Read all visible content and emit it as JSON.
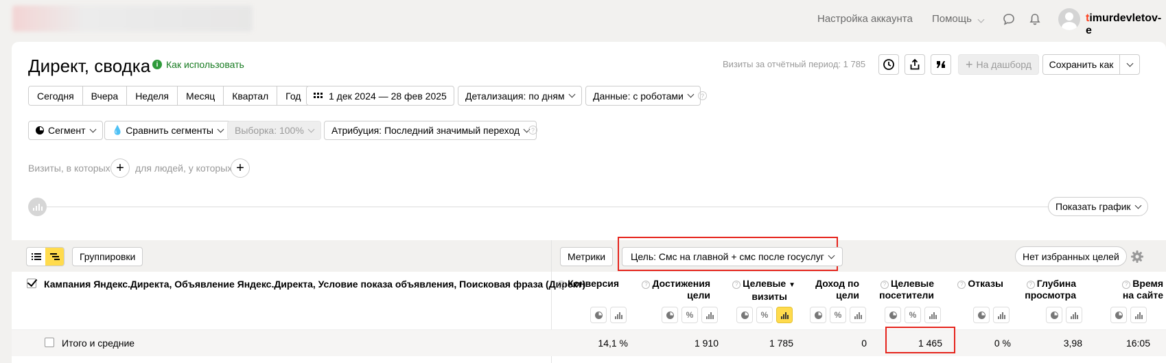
{
  "header": {
    "account_settings": "Настройка аккаунта",
    "help": "Помощь",
    "username_first": "t",
    "username_rest": "imurdevletov-e"
  },
  "page": {
    "title": "Директ, сводка",
    "how_to_use": "Как использовать",
    "visits_info": "Визиты за отчётный период: 1 785",
    "add_dashboard": "На дашборд",
    "save_as": "Сохранить как"
  },
  "periods": [
    "Сегодня",
    "Вчера",
    "Неделя",
    "Месяц",
    "Квартал",
    "Год"
  ],
  "filters": {
    "date_range": "1 дек 2024 — 28 фев 2025",
    "detail": "Детализация: по дням",
    "data": "Данные: с роботами",
    "segment": "Сегмент",
    "compare": "Сравнить сегменты",
    "sample": "Выборка: 100%",
    "attribution": "Атрибуция: Последний значимый переход"
  },
  "conditions": {
    "visits_where": "Визиты, в которых",
    "people_where": "для людей, у которых"
  },
  "graph": {
    "show_graph": "Показать график"
  },
  "table_toolbar": {
    "groupings": "Группировки",
    "metrics": "Метрики",
    "goal": "Цель: Смс на главной + смс после госуслуг",
    "favorites": "Нет избранных целей"
  },
  "table": {
    "dimensions": "Кампания Яндекс.Директа, Объявление Яндекс.Директа, Условие показа объявления, Поисковая фраза (Директ)",
    "columns": [
      {
        "l1": "Конверсия",
        "l2": ""
      },
      {
        "l1": "Достижения",
        "l2": "цели"
      },
      {
        "l1": "Целевые",
        "l2": "визиты"
      },
      {
        "l1": "Доход по",
        "l2": "цели"
      },
      {
        "l1": "Целевые",
        "l2": "посетители"
      },
      {
        "l1": "Отказы",
        "l2": ""
      },
      {
        "l1": "Глубина",
        "l2": "просмотра"
      },
      {
        "l1": "Время",
        "l2": "на сайте"
      }
    ],
    "sort_arrow": "▼",
    "total_label": "Итого и средние",
    "totals": [
      "14,1 %",
      "1 910",
      "1 785",
      "0",
      "1 465",
      "0 %",
      "3,98",
      "16:05"
    ]
  }
}
